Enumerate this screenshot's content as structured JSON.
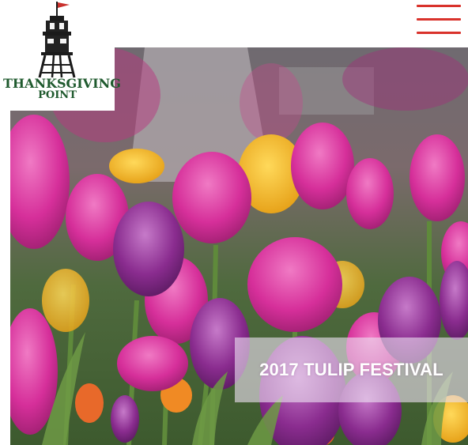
{
  "site": {
    "logo_line1": "THANKSGIVING",
    "logo_line2": "POINT"
  },
  "header": {
    "menu_icon": "hamburger-menu-icon"
  },
  "hero": {
    "banner_text": "2017 TULIP FESTIVAL"
  },
  "colors": {
    "brand_green": "#1f5a2e",
    "menu_red": "#d9322b",
    "tulip_pink": "#d62f9a",
    "tulip_purple": "#8a2c8f",
    "tulip_yellow": "#f2b21c"
  }
}
